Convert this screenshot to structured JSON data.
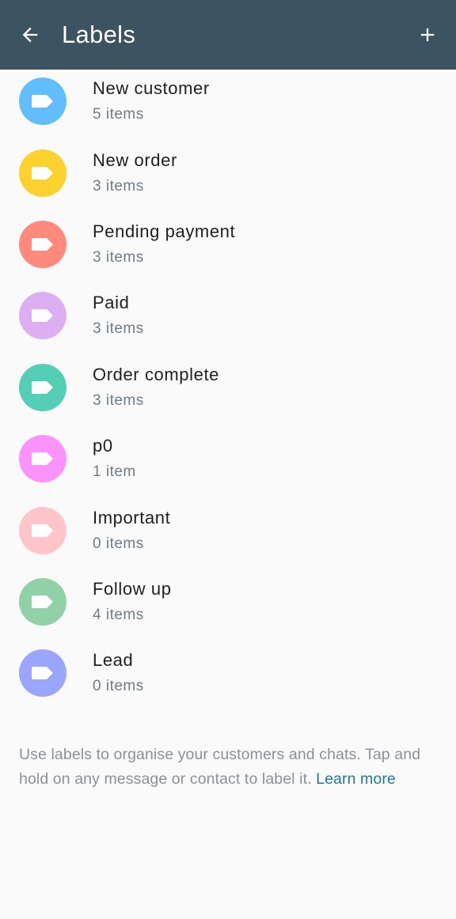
{
  "toolbar": {
    "title": "Labels",
    "back_icon": "arrow-left-icon",
    "add_icon": "plus-icon"
  },
  "labels": [
    {
      "name": "New customer",
      "count": "5 items",
      "color": "#62bdfc"
    },
    {
      "name": "New order",
      "count": "3 items",
      "color": "#fdd22f"
    },
    {
      "name": "Pending payment",
      "count": "3 items",
      "color": "#fe8a7c"
    },
    {
      "name": "Paid",
      "count": "3 items",
      "color": "#ddaff2"
    },
    {
      "name": "Order complete",
      "count": "3 items",
      "color": "#54cfb5"
    },
    {
      "name": "p0",
      "count": "1 item",
      "color": "#fc92fb"
    },
    {
      "name": "Important",
      "count": "0 items",
      "color": "#ffc5c8"
    },
    {
      "name": "Follow up",
      "count": "4 items",
      "color": "#91d1a8"
    },
    {
      "name": "Lead",
      "count": "0 items",
      "color": "#9aa5fd"
    }
  ],
  "footer": {
    "text": "Use labels to organise your customers and chats. Tap and hold on any message or contact to label it.",
    "link": "Learn more"
  }
}
